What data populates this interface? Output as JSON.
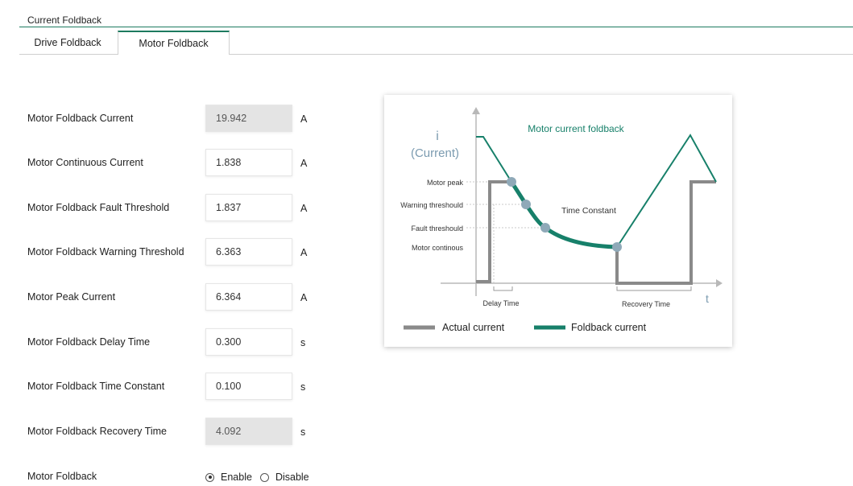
{
  "section": {
    "title": "Current Foldback"
  },
  "tabs": [
    {
      "label": "Drive Foldback",
      "active": false
    },
    {
      "label": "Motor Foldback",
      "active": true
    }
  ],
  "fields": [
    {
      "label": "Motor Foldback Current",
      "value": "19.942",
      "unit": "A",
      "readonly": true
    },
    {
      "label": "Motor Continuous Current",
      "value": "1.838",
      "unit": "A",
      "readonly": false
    },
    {
      "label": "Motor Foldback Fault Threshold",
      "value": "1.837",
      "unit": "A",
      "readonly": false
    },
    {
      "label": "Motor Foldback Warning Threshold",
      "value": "6.363",
      "unit": "A",
      "readonly": false
    },
    {
      "label": "Motor Peak Current",
      "value": "6.364",
      "unit": "A",
      "readonly": false
    },
    {
      "label": "Motor Foldback Delay Time",
      "value": "0.300",
      "unit": "s",
      "readonly": false
    },
    {
      "label": "Motor Foldback Time Constant",
      "value": "0.100",
      "unit": "s",
      "readonly": false
    },
    {
      "label": "Motor Foldback Recovery Time",
      "value": "4.092",
      "unit": "s",
      "readonly": true
    }
  ],
  "motor_foldback": {
    "label": "Motor Foldback",
    "options": [
      {
        "label": "Enable",
        "selected": true
      },
      {
        "label": "Disable",
        "selected": false
      }
    ]
  },
  "diagram": {
    "title": "Motor current foldback",
    "y_axis_symbol": "i",
    "y_axis_label": "(Current)",
    "x_axis_symbol": "t",
    "level_labels": [
      "Motor peak",
      "Warning threshould",
      "Fault threshould",
      "Motor continous"
    ],
    "annotation_time_constant": "Time Constant",
    "annotation_delay_time": "Delay Time",
    "annotation_recovery_time": "Recovery Time",
    "legend": [
      {
        "label": "Actual current",
        "color": "#8a8a8a"
      },
      {
        "label": "Foldback current",
        "color": "#17806a"
      }
    ],
    "colors": {
      "axis": "#b8b8b8",
      "foldback": "#17806a",
      "actual": "#8a8a8a",
      "marker": "#8fa9b8",
      "y_label": "#7b9bb0"
    }
  }
}
